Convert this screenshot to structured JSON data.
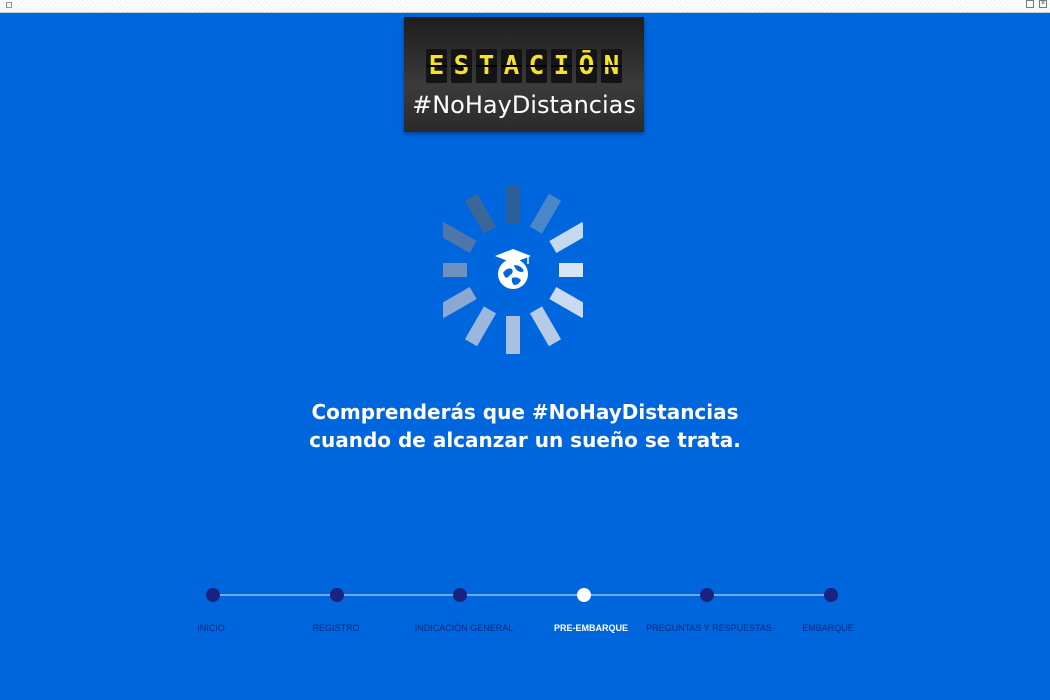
{
  "logo": {
    "letters": [
      "E",
      "S",
      "T",
      "A",
      "C",
      "I",
      "Ō",
      "N"
    ],
    "hashtag": "#NoHayDistancias"
  },
  "message": {
    "line1": "Comprenderás que #NoHayDistancias",
    "line2": "cuando de alcanzar un sueño se trata."
  },
  "steps": [
    {
      "label": "INICIO",
      "active": false
    },
    {
      "label": "REGISTRO",
      "active": false
    },
    {
      "label": "INDICACIÓN GENERAL",
      "active": false
    },
    {
      "label": "PRE-EMBARQUE",
      "active": true
    },
    {
      "label": "PREGUNTAS Y RESPUESTAS",
      "active": false
    },
    {
      "label": "EMBARQUE",
      "active": false
    }
  ],
  "icons": {
    "spinner": "loading-spinner",
    "center": "graduation-globe-icon"
  },
  "colors": {
    "background": "#0066dd",
    "step_inactive": "#1a237e",
    "step_active": "#ffffff",
    "logo_text": "#f5e32b"
  }
}
